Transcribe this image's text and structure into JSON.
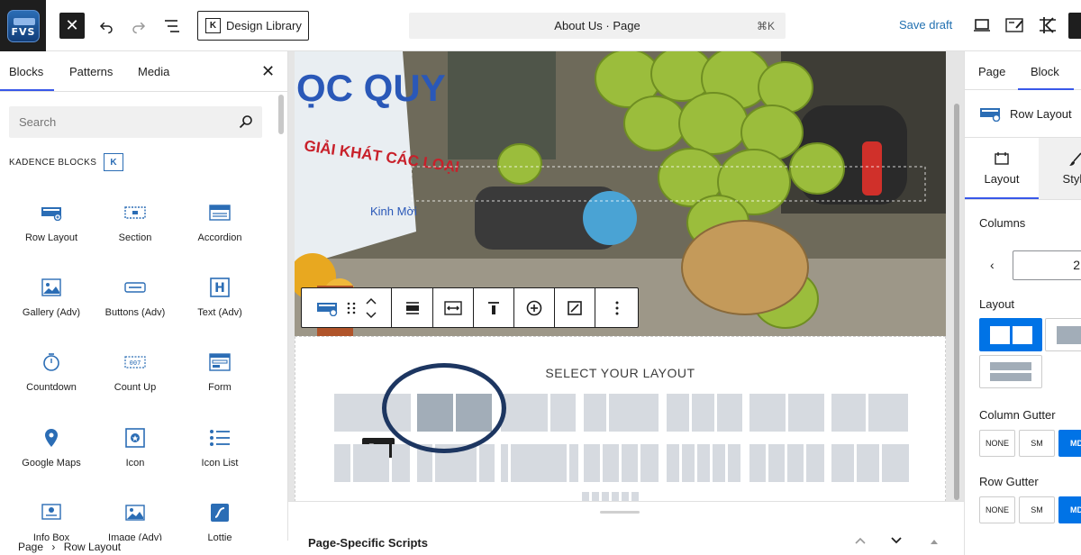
{
  "topbar": {
    "logo_text": "FVS",
    "close": "✕",
    "undo": "↶",
    "redo": "↷",
    "outline": "☰",
    "design_library": "Design Library",
    "title": "About Us · Page",
    "shortcut": "⌘K",
    "save_draft": "Save draft"
  },
  "left_panel": {
    "tabs": [
      "Blocks",
      "Patterns",
      "Media"
    ],
    "close": "✕",
    "search_placeholder": "Search",
    "section_label": "KADENCE BLOCKS",
    "blocks": [
      {
        "label": "Row Layout",
        "icon": "row-layout-icon"
      },
      {
        "label": "Section",
        "icon": "section-icon"
      },
      {
        "label": "Accordion",
        "icon": "accordion-icon"
      },
      {
        "label": "Gallery (Adv)",
        "icon": "gallery-icon"
      },
      {
        "label": "Buttons (Adv)",
        "icon": "buttons-icon"
      },
      {
        "label": "Text (Adv)",
        "icon": "text-icon"
      },
      {
        "label": "Countdown",
        "icon": "countdown-icon"
      },
      {
        "label": "Count Up",
        "icon": "count-up-icon"
      },
      {
        "label": "Form",
        "icon": "form-icon"
      },
      {
        "label": "Google Maps",
        "icon": "map-pin-icon"
      },
      {
        "label": "Icon",
        "icon": "icon-icon"
      },
      {
        "label": "Icon List",
        "icon": "icon-list-icon"
      },
      {
        "label": "Info Box",
        "icon": "info-box-icon"
      },
      {
        "label": "Image (Adv)",
        "icon": "image-icon"
      },
      {
        "label": "Lottie",
        "icon": "lottie-icon"
      }
    ]
  },
  "canvas": {
    "photo_sign_line1": "ỌC QUY",
    "photo_sign_line2": "GIẢI KHÁT CÁC LOẠI",
    "photo_sign_line3": "Kinh Mời",
    "select_layout_title": "SELECT YOUR LAYOUT",
    "tooltip": "Row",
    "bottom_panel_title": "Page-Specific Scripts"
  },
  "breadcrumb": {
    "items": [
      "Page",
      "Row Layout"
    ],
    "sep": "›"
  },
  "right_panel": {
    "tabs": [
      "Page",
      "Block"
    ],
    "block_name": "Row Layout",
    "layout_tabs": [
      "Layout",
      "Style"
    ],
    "columns_label": "Columns",
    "columns_value": "2",
    "layout_label": "Layout",
    "column_gutter_label": "Column Gutter",
    "row_gutter_label": "Row Gutter",
    "gutter_options": [
      "NONE",
      "SM",
      "MD"
    ]
  },
  "colors": {
    "accent": "#3858e9",
    "selected_button": "#0073e6",
    "save_draft": "#2271b1",
    "highlight_ring": "#1d3661"
  }
}
